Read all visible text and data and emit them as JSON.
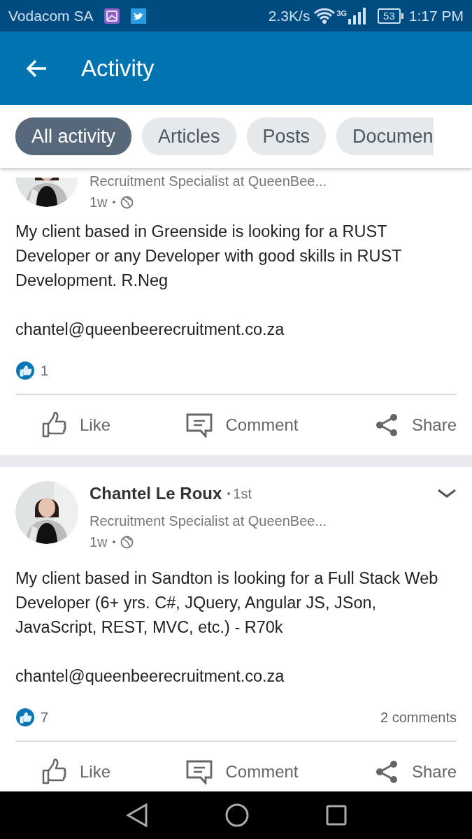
{
  "status_bar": {
    "carrier": "Vodacom SA",
    "speed": "2.3K/s",
    "network": "3G",
    "battery": "53",
    "time": "1:17 PM"
  },
  "app_bar": {
    "title": "Activity"
  },
  "tabs": [
    {
      "label": "All activity",
      "selected": true
    },
    {
      "label": "Articles",
      "selected": false
    },
    {
      "label": "Posts",
      "selected": false
    },
    {
      "label": "Documen",
      "selected": false
    }
  ],
  "posts": [
    {
      "headline": "Recruitment Specialist at QueenBee...",
      "time": "1w",
      "paragraphs": [
        "My client based in Greenside is looking for a RUST Developer or any Developer with good skills in RUST Development. R.Neg",
        "chantel@queenbeerecruitment.co.za"
      ],
      "likes": "1",
      "actions": [
        {
          "kind": "like",
          "label": "Like"
        },
        {
          "kind": "comment",
          "label": "Comment"
        },
        {
          "kind": "share",
          "label": "Share"
        }
      ]
    },
    {
      "author": "Chantel Le Roux",
      "degree": "1st",
      "headline": "Recruitment Specialist at QueenBee...",
      "time": "1w",
      "paragraphs": [
        "My client based in Sandton is looking for a Full Stack Web Developer (6+ yrs. C#, JQuery, Angular JS, JSon, JavaScript, REST, MVC, etc.) - R70k",
        "chantel@queenbeerecruitment.co.za"
      ],
      "likes": "7",
      "comments": "2 comments",
      "actions": [
        {
          "kind": "like",
          "label": "Like"
        },
        {
          "kind": "comment",
          "label": "Comment"
        },
        {
          "kind": "share",
          "label": "Share"
        }
      ]
    }
  ]
}
